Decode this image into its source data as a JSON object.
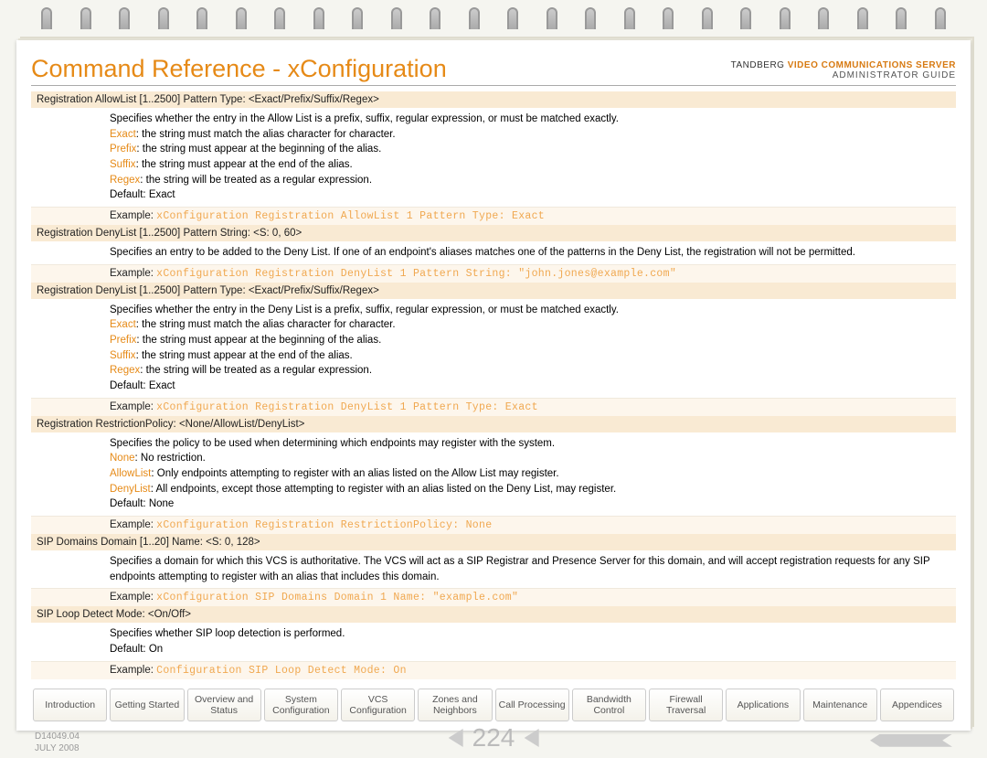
{
  "header": {
    "title": "Command Reference - xConfiguration",
    "brand_prefix": "TANDBERG",
    "brand_suffix": "VIDEO COMMUNICATIONS SERVER",
    "subtitle": "ADMINISTRATOR GUIDE"
  },
  "sections": [
    {
      "head": "Registration AllowList [1..2500] Pattern Type: <Exact/Prefix/Suffix/Regex>",
      "desc_lines": [
        {
          "pre": "Specifies whether the entry in the Allow List is a prefix, suffix, regular expression, or must be matched exactly."
        },
        {
          "kw": "Exact",
          "rest": ": the string must match the alias character for character."
        },
        {
          "kw": "Prefix",
          "rest": ": the string must appear at the beginning of the alias."
        },
        {
          "kw": "Suffix",
          "rest": ": the string must appear at the end of the alias."
        },
        {
          "kw": "Regex",
          "rest": ": the string will be treated as a regular expression."
        },
        {
          "pre": "Default: Exact"
        }
      ],
      "example_label": "Example:",
      "example_code": "xConfiguration Registration AllowList 1 Pattern Type: Exact"
    },
    {
      "head": "Registration DenyList [1..2500] Pattern String: <S: 0, 60>",
      "desc_lines": [
        {
          "pre": "Specifies an entry to be added to the Deny List. If one of an endpoint's aliases matches one of the patterns in the Deny List, the registration will not be permitted."
        }
      ],
      "example_label": "Example:",
      "example_code": "xConfiguration Registration DenyList 1 Pattern String: \"john.jones@example.com\""
    },
    {
      "head": "Registration DenyList [1..2500] Pattern Type: <Exact/Prefix/Suffix/Regex>",
      "desc_lines": [
        {
          "pre": "Specifies whether the entry in the Deny List is a prefix, suffix, regular expression, or must be matched exactly."
        },
        {
          "kw": "Exact",
          "rest": ": the string must match the alias character for character."
        },
        {
          "kw": "Prefix",
          "rest": ": the string must appear at the beginning of the alias."
        },
        {
          "kw": "Suffix",
          "rest": ": the string must appear at the end of the alias."
        },
        {
          "kw": "Regex",
          "rest": ": the string will be treated as a regular expression."
        },
        {
          "pre": "Default: Exact"
        }
      ],
      "example_label": "Example:",
      "example_code": "xConfiguration Registration DenyList 1 Pattern Type: Exact"
    },
    {
      "head": "Registration RestrictionPolicy: <None/AllowList/DenyList>",
      "desc_lines": [
        {
          "pre": "Specifies the policy to be used when determining which endpoints may register with the system."
        },
        {
          "kw": "None",
          "rest": ": No restriction."
        },
        {
          "kw": "AllowList",
          "rest": ": Only endpoints attempting to register with an alias listed on the Allow List may register."
        },
        {
          "kw": "DenyList",
          "rest": ": All endpoints, except those attempting to register with an alias listed on the Deny List, may register."
        },
        {
          "pre": "Default: None"
        }
      ],
      "example_label": "Example:",
      "example_code": "xConfiguration Registration RestrictionPolicy: None"
    },
    {
      "head": "SIP Domains Domain [1..20] Name: <S: 0, 128>",
      "desc_lines": [
        {
          "pre": "Specifies a domain for which this VCS is authoritative. The VCS will act as a SIP Registrar and Presence Server for this domain, and will accept registration requests for any SIP endpoints attempting to register with an alias that includes this domain."
        }
      ],
      "example_label": "Example:",
      "example_code": "xConfiguration SIP Domains Domain 1 Name: \"example.com\""
    },
    {
      "head": "SIP Loop Detect Mode: <On/Off>",
      "desc_lines": [
        {
          "pre": "Specifies whether SIP loop detection is performed."
        },
        {
          "pre": "Default: On"
        }
      ],
      "example_label": "Example:",
      "example_code": "Configuration SIP Loop Detect Mode: On"
    }
  ],
  "nav": [
    "Introduction",
    "Getting Started",
    "Overview and Status",
    "System Configuration",
    "VCS Configuration",
    "Zones and Neighbors",
    "Call Processing",
    "Bandwidth Control",
    "Firewall Traversal",
    "Applications",
    "Maintenance",
    "Appendices"
  ],
  "footer": {
    "docnum": "D14049.04",
    "date": "JULY 2008",
    "page": "224"
  }
}
